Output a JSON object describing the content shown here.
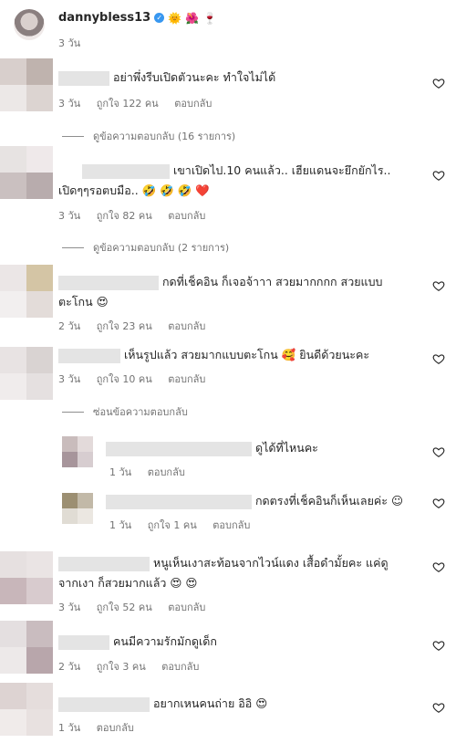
{
  "post": {
    "username": "dannybless13",
    "emojis": "🌞 🌺 🍷",
    "time": "3 วัน"
  },
  "reply_label": "ตอบกลับ",
  "comments": [
    {
      "text": "อย่าพึ่งรีบเปิดตัวนะคะ ทำใจไม่ได้",
      "time": "3 วัน",
      "likes": "ถูกใจ 122 คน",
      "view_replies": "ดูข้อความตอบกลับ (16 รายการ)"
    },
    {
      "text1": "เขาเปิดไป.10 คนแล้ว.. เฮียแดนจะยึกยักไร..",
      "text2": "เปิดๆๆรอตบมือ.. 🤣 🤣 🤣 ❤️",
      "time": "3 วัน",
      "likes": "ถูกใจ 82 คน",
      "view_replies": "ดูข้อความตอบกลับ (2 รายการ)"
    },
    {
      "text1": "กดที่เช็คอิน ก็เจอจ้าาา สวยมากกกก สวยแบบ",
      "text2": "ตะโกน 😍",
      "time": "2 วัน",
      "likes": "ถูกใจ 23 คน"
    },
    {
      "text": "เห็นรูปแล้ว สวยมากแบบตะโกน 🥰 ยินดีด้วยนะคะ",
      "time": "3 วัน",
      "likes": "ถูกใจ 10 คน",
      "hide_replies": "ซ่อนข้อความตอบกลับ",
      "replies": [
        {
          "text": "ดูได้ที่ไหนคะ",
          "time": "1 วัน"
        },
        {
          "text": "กดตรงที่เช็คอินก็เห็นเลยค่ะ ☺",
          "time": "1 วัน",
          "likes": "ถูกใจ 1 คน"
        }
      ]
    },
    {
      "text1": "หนูเห็นเงาสะท้อนจากไวน์แดง เสื้อดำมั้ยคะ แค่ดู",
      "text2": "จากเงา ก็สวยมากแล้ว 😍 😍",
      "time": "3 วัน",
      "likes": "ถูกใจ 52 คน"
    },
    {
      "text": "คนมีความรักมักดูเด็ก",
      "time": "2 วัน",
      "likes": "ถูกใจ 3 คน"
    },
    {
      "text": "อยากเหนคนถ่าย อิอิ 😍",
      "time": "1 วัน"
    }
  ]
}
